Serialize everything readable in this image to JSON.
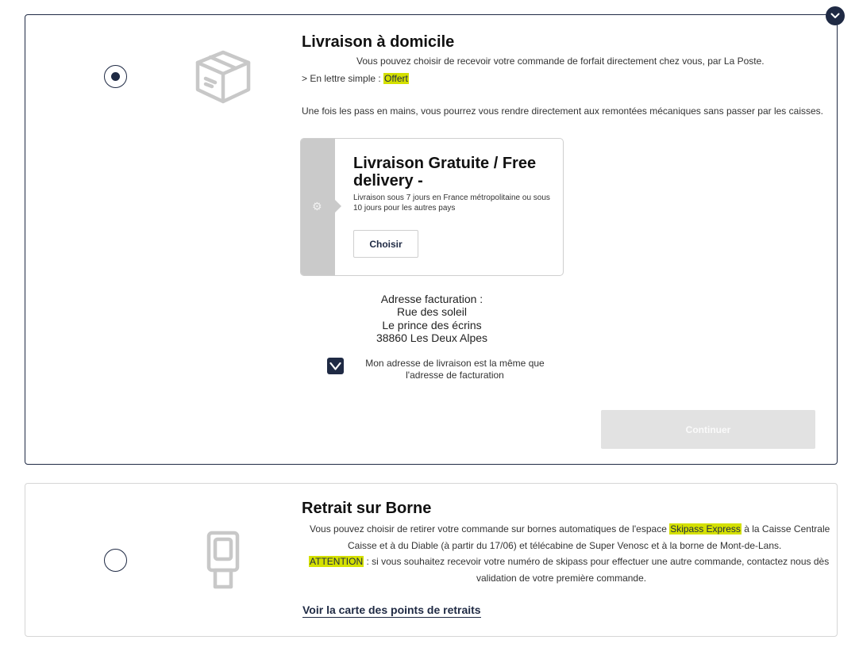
{
  "home_delivery": {
    "title": "Livraison à domicile",
    "description": "Vous pouvez choisir de recevoir votre commande de forfait directement chez vous, par La Poste.",
    "simple_letter_prefix": "> En lettre simple : ",
    "simple_letter_value": "Offert",
    "info": "Une fois les pass en mains, vous pourrez vous rendre directement aux remontées mécaniques sans passer par les caisses.",
    "selected": true,
    "option": {
      "title": "Livraison Gratuite / Free delivery -",
      "subtitle": "Livraison sous 7 jours en France métropolitaine ou sous 10 jours pour les autres pays",
      "button_label": "Choisir"
    },
    "billing": {
      "heading": "Adresse facturation :",
      "line1": "Rue des soleil",
      "line2": "Le prince des écrins",
      "line3": "38860 Les Deux Alpes"
    },
    "same_address": {
      "checked": true,
      "label": "Mon adresse de livraison est la même que l'adresse de facturation"
    },
    "continue_label": "Continuer"
  },
  "borne": {
    "title": "Retrait sur Borne",
    "line1_before": "Vous pouvez choisir de retirer votre commande sur bornes automatiques de l'espace ",
    "line1_highlight": "Skipass Express",
    "line1_after": " à la Caisse Centrale",
    "line2": "Caisse et à du Diable (à partir du 17/06) et télécabine de Super Venosc et à la borne de Mont-de-Lans.",
    "attention_label": "ATTENTION",
    "attention_text": " : si vous souhaitez recevoir votre numéro de skipass pour effectuer une autre commande, contactez nous dès",
    "line4": "validation de votre première commande.",
    "map_link": "Voir la carte des points de retraits",
    "selected": false
  },
  "icons": {
    "collapse": "chevron-down-icon",
    "home": "package-box-icon",
    "borne": "kiosk-terminal-icon",
    "option": "gear-icon",
    "check": "checkmark-icon"
  },
  "colors": {
    "navy": "#1f2a44",
    "highlight": "#d4e000",
    "disabled_button": "#e2e2e2",
    "strip_grey": "#cacaca"
  }
}
